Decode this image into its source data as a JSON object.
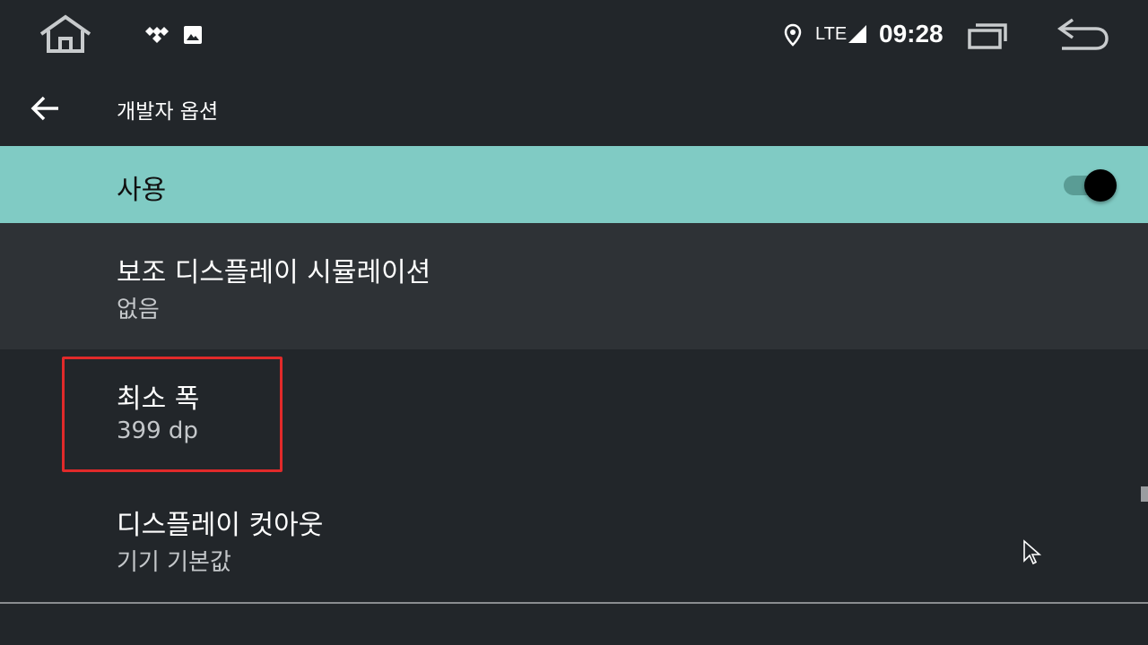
{
  "status_bar": {
    "network": "LTE",
    "time": "09:28",
    "icons": [
      "home-icon",
      "tidal-icon",
      "image-icon",
      "location-icon",
      "signal-icon",
      "recents-icon",
      "back-icon"
    ]
  },
  "app_bar": {
    "back_icon": "arrow-back-icon",
    "title": "개발자 옵션"
  },
  "main_switch": {
    "label": "사용",
    "enabled": true
  },
  "settings": [
    {
      "title": "보조 디스플레이 시뮬레이션",
      "summary": "없음"
    },
    {
      "title": "최소 폭",
      "summary": "399 dp"
    },
    {
      "title": "디스플레이 컷아웃",
      "summary": "기기 기본값"
    }
  ],
  "colors": {
    "background": "#22262a",
    "switch_row": "#80cbc4",
    "pressed_row": "#2e3236",
    "highlight": "#e12a2a"
  }
}
